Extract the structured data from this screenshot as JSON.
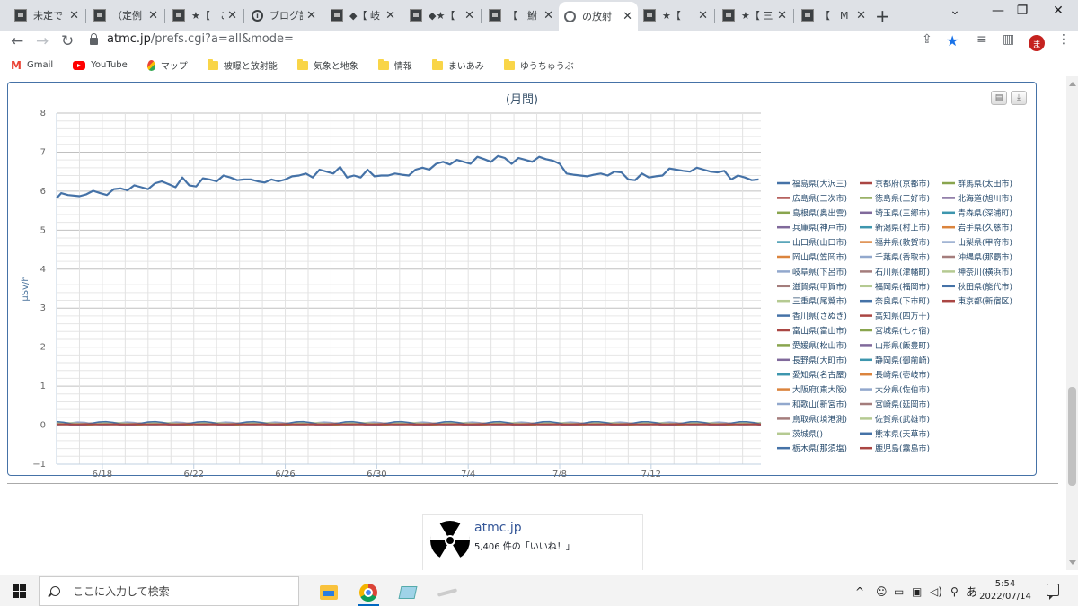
{
  "tabs": [
    {
      "title": "未定で",
      "icon": "doc-icon"
    },
    {
      "title": "（定例",
      "icon": "doc-icon"
    },
    {
      "title": "★【　こ",
      "icon": "doc-icon"
    },
    {
      "title": "ブログ記",
      "icon": "info-icon"
    },
    {
      "title": "◆【 岐",
      "icon": "doc-icon"
    },
    {
      "title": "◆★【",
      "icon": "doc-icon"
    },
    {
      "title": "【　鮒",
      "icon": "doc-icon"
    },
    {
      "title": "の放射",
      "icon": "globe-icon",
      "active": true
    },
    {
      "title": "★【　",
      "icon": "doc-icon"
    },
    {
      "title": "★【 三",
      "icon": "doc-icon"
    },
    {
      "title": "【　M",
      "icon": "doc-icon"
    }
  ],
  "address": {
    "host": "atmc.jp",
    "path": "/prefs.cgi?a=all&mode="
  },
  "avatar_letter": "ま",
  "bookmarks": [
    {
      "label": "Gmail",
      "icon": "gmail-icon"
    },
    {
      "label": "YouTube",
      "icon": "youtube-icon"
    },
    {
      "label": "マップ",
      "icon": "maps-icon"
    },
    {
      "label": "被曝と放射能",
      "icon": "folder-icon"
    },
    {
      "label": "気象と地象",
      "icon": "folder-icon"
    },
    {
      "label": "情報",
      "icon": "folder-icon"
    },
    {
      "label": "まいあみ",
      "icon": "folder-icon"
    },
    {
      "label": "ゆうちゅうぶ",
      "icon": "folder-icon"
    }
  ],
  "chart_data": {
    "type": "line",
    "title": "(月間)",
    "ylabel": "μSv/h",
    "xlabel": "",
    "ylim": [
      -1,
      8
    ],
    "yticks": [
      "8",
      "7",
      "6",
      "5",
      "4",
      "3",
      "2",
      "1",
      "0",
      "−1"
    ],
    "xticks": [
      "6/18",
      "6/22",
      "6/26",
      "6/30",
      "7/4",
      "7/8",
      "7/12"
    ],
    "grid": true,
    "legend_position": "right",
    "main_series": {
      "name": "福島県(大沢三)",
      "x_day_offset_from_6_16": [
        0,
        0.2,
        0.5,
        1,
        1.3,
        1.6,
        1.9,
        2.2,
        2.5,
        2.8,
        3.1,
        3.4,
        3.7,
        4,
        4.3,
        4.6,
        4.9,
        5.2,
        5.5,
        5.8,
        6.1,
        6.4,
        6.7,
        7,
        7.3,
        7.6,
        7.9,
        8.2,
        8.5,
        8.8,
        9.1,
        9.4,
        9.7,
        10,
        10.3,
        10.6,
        10.9,
        11.2,
        11.5,
        11.8,
        12.1,
        12.4,
        12.7,
        13,
        13.3,
        13.6,
        13.9,
        14.2,
        14.5,
        14.8,
        15.1,
        15.4,
        15.7,
        16,
        16.3,
        16.6,
        16.9,
        17.2,
        17.5,
        17.8,
        18.1,
        18.4,
        18.7,
        19,
        19.3,
        19.6,
        19.9,
        20.2,
        20.5,
        20.8,
        21.1,
        21.4,
        21.7,
        22,
        22.3,
        22.6,
        22.9,
        23.2,
        23.5,
        23.8,
        24.1,
        24.4,
        24.7,
        25,
        25.3,
        25.6,
        25.9,
        26.2,
        26.5,
        26.8,
        27.1,
        27.4,
        27.7,
        28,
        28.3,
        28.6,
        28.9,
        29.2,
        29.5,
        29.8,
        30.1,
        30.4,
        30.7
      ],
      "values": [
        5.82,
        5.95,
        5.9,
        5.87,
        5.92,
        6.01,
        5.95,
        5.9,
        6.05,
        6.07,
        6.02,
        6.15,
        6.1,
        6.05,
        6.2,
        6.25,
        6.18,
        6.1,
        6.35,
        6.15,
        6.12,
        6.33,
        6.3,
        6.25,
        6.4,
        6.35,
        6.28,
        6.3,
        6.3,
        6.25,
        6.22,
        6.3,
        6.25,
        6.3,
        6.38,
        6.4,
        6.45,
        6.35,
        6.55,
        6.5,
        6.45,
        6.62,
        6.35,
        6.4,
        6.35,
        6.55,
        6.38,
        6.4,
        6.4,
        6.45,
        6.42,
        6.4,
        6.55,
        6.6,
        6.55,
        6.7,
        6.75,
        6.68,
        6.8,
        6.75,
        6.7,
        6.88,
        6.82,
        6.75,
        6.9,
        6.85,
        6.7,
        6.85,
        6.8,
        6.75,
        6.88,
        6.82,
        6.78,
        6.7,
        6.45,
        6.42,
        6.4,
        6.38,
        6.42,
        6.45,
        6.4,
        6.5,
        6.48,
        6.3,
        6.28,
        6.45,
        6.35,
        6.38,
        6.4,
        6.58,
        6.55,
        6.52,
        6.5,
        6.6,
        6.55,
        6.5,
        6.48,
        6.52,
        6.3,
        6.4,
        6.35,
        6.28,
        6.3
      ],
      "color": "#4572a7"
    },
    "low_band": {
      "approx_value": 0.05,
      "note_series_count": 47
    },
    "legend": [
      [
        {
          "name": "福島県(大沢三)",
          "color": "#4572a7"
        },
        {
          "name": "広島県(三次市)",
          "color": "#aa4643"
        },
        {
          "name": "島根県(奥出雲)",
          "color": "#89a54e"
        },
        {
          "name": "兵庫県(神戸市)",
          "color": "#80699b"
        },
        {
          "name": "山口県(山口市)",
          "color": "#3d96ae"
        },
        {
          "name": "岡山県(笠岡市)",
          "color": "#db843d"
        },
        {
          "name": "岐阜県(下呂市)",
          "color": "#92a8cd"
        },
        {
          "name": "滋賀県(甲賀市)",
          "color": "#a47d7c"
        },
        {
          "name": "三重県(尾鷲市)",
          "color": "#b5ca92"
        },
        {
          "name": "香川県(さぬき)",
          "color": "#4572a7"
        },
        {
          "name": "富山県(富山市)",
          "color": "#aa4643"
        },
        {
          "name": "愛媛県(松山市)",
          "color": "#89a54e"
        },
        {
          "name": "長野県(大町市)",
          "color": "#80699b"
        },
        {
          "name": "愛知県(名古屋)",
          "color": "#3d96ae"
        },
        {
          "name": "大阪府(東大阪)",
          "color": "#db843d"
        },
        {
          "name": "和歌山(新宮市)",
          "color": "#92a8cd"
        },
        {
          "name": "鳥取県(境港測)",
          "color": "#a47d7c"
        },
        {
          "name": "茨城県()",
          "color": "#b5ca92"
        },
        {
          "name": "栃木県(那須塩)",
          "color": "#4572a7"
        }
      ],
      [
        {
          "name": "京都府(京都市)",
          "color": "#aa4643"
        },
        {
          "name": "徳島県(三好市)",
          "color": "#89a54e"
        },
        {
          "name": "埼玉県(三郷市)",
          "color": "#80699b"
        },
        {
          "name": "新潟県(村上市)",
          "color": "#3d96ae"
        },
        {
          "name": "福井県(敦賀市)",
          "color": "#db843d"
        },
        {
          "name": "千葉県(香取市)",
          "color": "#92a8cd"
        },
        {
          "name": "石川県(津幡町)",
          "color": "#a47d7c"
        },
        {
          "name": "福岡県(福岡市)",
          "color": "#b5ca92"
        },
        {
          "name": "奈良県(下市町)",
          "color": "#4572a7"
        },
        {
          "name": "高知県(四万十)",
          "color": "#aa4643"
        },
        {
          "name": "宮城県(七ヶ宿)",
          "color": "#89a54e"
        },
        {
          "name": "山形県(飯豊町)",
          "color": "#80699b"
        },
        {
          "name": "静岡県(御前崎)",
          "color": "#3d96ae"
        },
        {
          "name": "長崎県(壱岐市)",
          "color": "#db843d"
        },
        {
          "name": "大分県(佐伯市)",
          "color": "#92a8cd"
        },
        {
          "name": "宮崎県(延岡市)",
          "color": "#a47d7c"
        },
        {
          "name": "佐賀県(武雄市)",
          "color": "#b5ca92"
        },
        {
          "name": "熊本県(天草市)",
          "color": "#4572a7"
        },
        {
          "name": "鹿児島(霧島市)",
          "color": "#aa4643"
        }
      ],
      [
        {
          "name": "群馬県(太田市)",
          "color": "#89a54e"
        },
        {
          "name": "北海道(旭川市)",
          "color": "#80699b"
        },
        {
          "name": "青森県(深浦町)",
          "color": "#3d96ae"
        },
        {
          "name": "岩手県(久慈市)",
          "color": "#db843d"
        },
        {
          "name": "山梨県(甲府市)",
          "color": "#92a8cd"
        },
        {
          "name": "沖縄県(那覇市)",
          "color": "#a47d7c"
        },
        {
          "name": "神奈川(横浜市)",
          "color": "#b5ca92"
        },
        {
          "name": "秋田県(能代市)",
          "color": "#4572a7"
        },
        {
          "name": "東京都(新宿区)",
          "color": "#aa4643"
        }
      ]
    ]
  },
  "fb": {
    "name": "atmc.jp",
    "likes": "5,406 件の「いいね！」"
  },
  "taskbar": {
    "search_placeholder": "ここに入力して検索",
    "time": "5:54",
    "date": "2022/07/14",
    "ime": "あ"
  }
}
